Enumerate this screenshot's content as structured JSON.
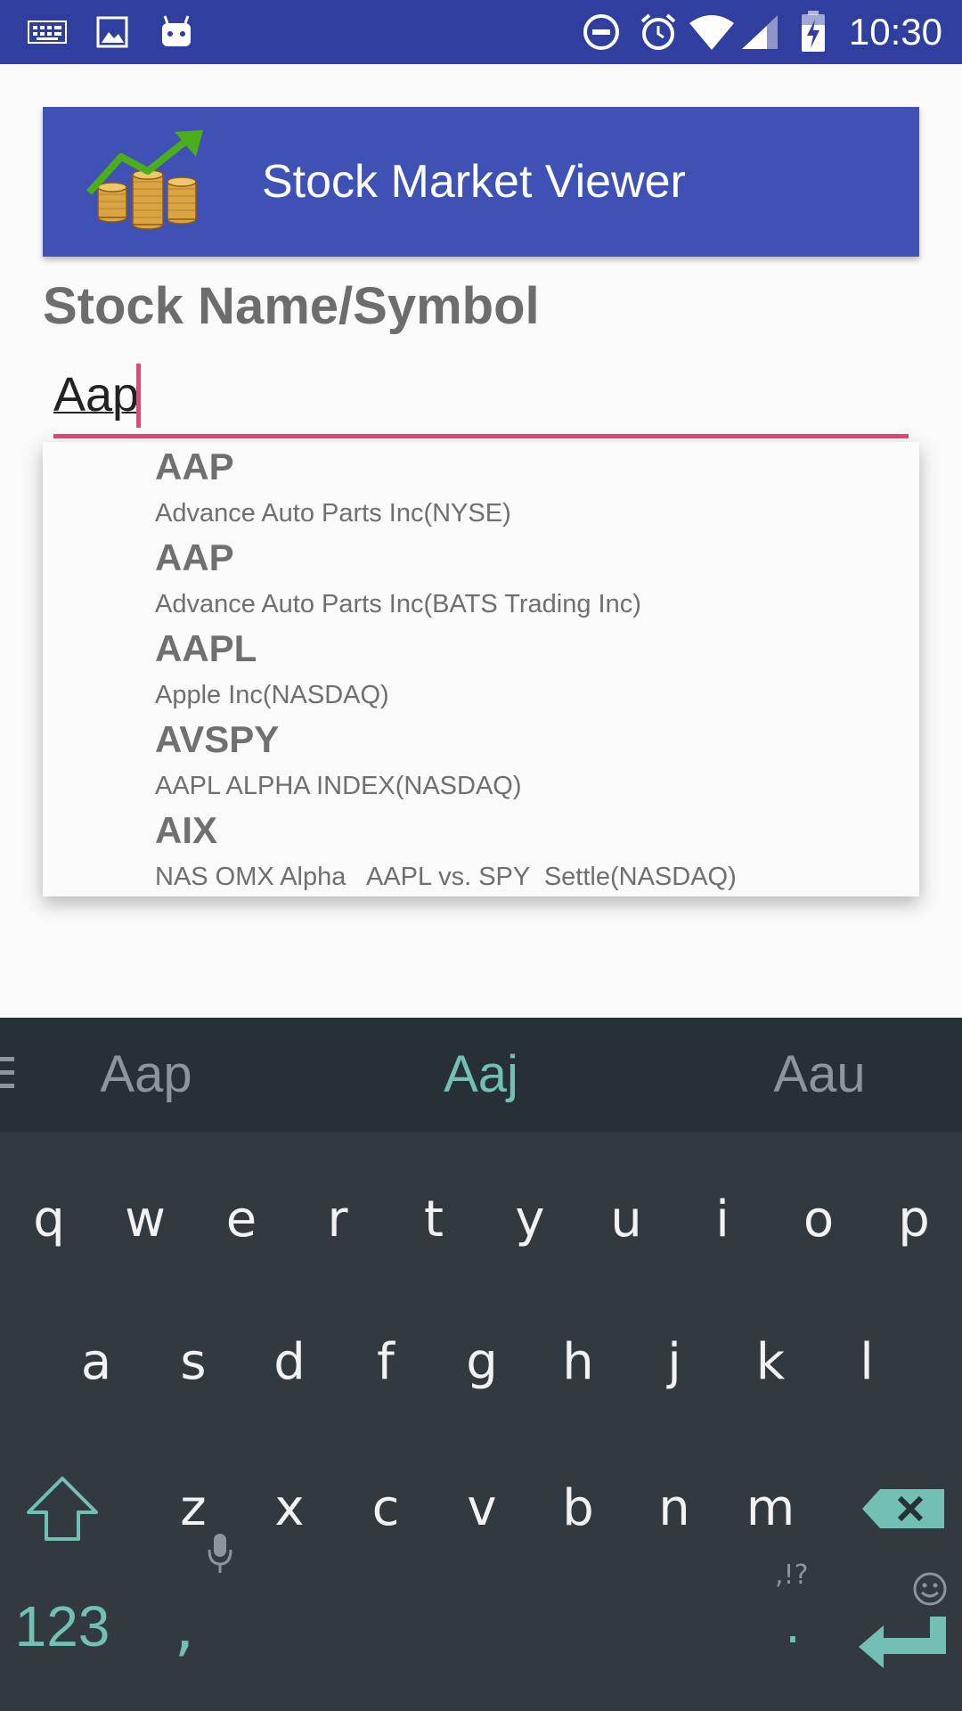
{
  "status_bar": {
    "time": "10:30",
    "icons": [
      "keyboard-icon",
      "image-icon",
      "android-icon",
      "do-not-disturb-icon",
      "alarm-icon",
      "wifi-icon",
      "signal-icon",
      "battery-charging-icon"
    ]
  },
  "app": {
    "title": "Stock Market Viewer",
    "field_label": "Stock Name/Symbol",
    "search_value": "Aap"
  },
  "suggestions": [
    {
      "symbol": "AAP",
      "name": "Advance Auto Parts Inc(NYSE)"
    },
    {
      "symbol": "AAP",
      "name": "Advance Auto Parts Inc(BATS Trading Inc)"
    },
    {
      "symbol": "AAPL",
      "name": "Apple Inc(NASDAQ)"
    },
    {
      "symbol": "AVSPY",
      "name": "AAPL ALPHA INDEX(NASDAQ)"
    },
    {
      "symbol": "AIX",
      "name": "NAS OMX Alpha   AAPL vs. SPY  Settle(NASDAQ)"
    }
  ],
  "keyboard": {
    "suggestions": [
      "Aap",
      "Aaj",
      "Aau"
    ],
    "row1": [
      "q",
      "w",
      "e",
      "r",
      "t",
      "y",
      "u",
      "i",
      "o",
      "p"
    ],
    "row2": [
      "a",
      "s",
      "d",
      "f",
      "g",
      "h",
      "j",
      "k",
      "l"
    ],
    "row3": [
      "z",
      "x",
      "c",
      "v",
      "b",
      "n",
      "m"
    ],
    "numbers_label": "123",
    "comma_label": ",",
    "period_label": ".",
    "punct_hint": ",!?",
    "accent_color": "#72c0b3"
  },
  "colors": {
    "primary_dark": "#303f9f",
    "primary": "#3f51b5",
    "accent": "#e94377"
  }
}
